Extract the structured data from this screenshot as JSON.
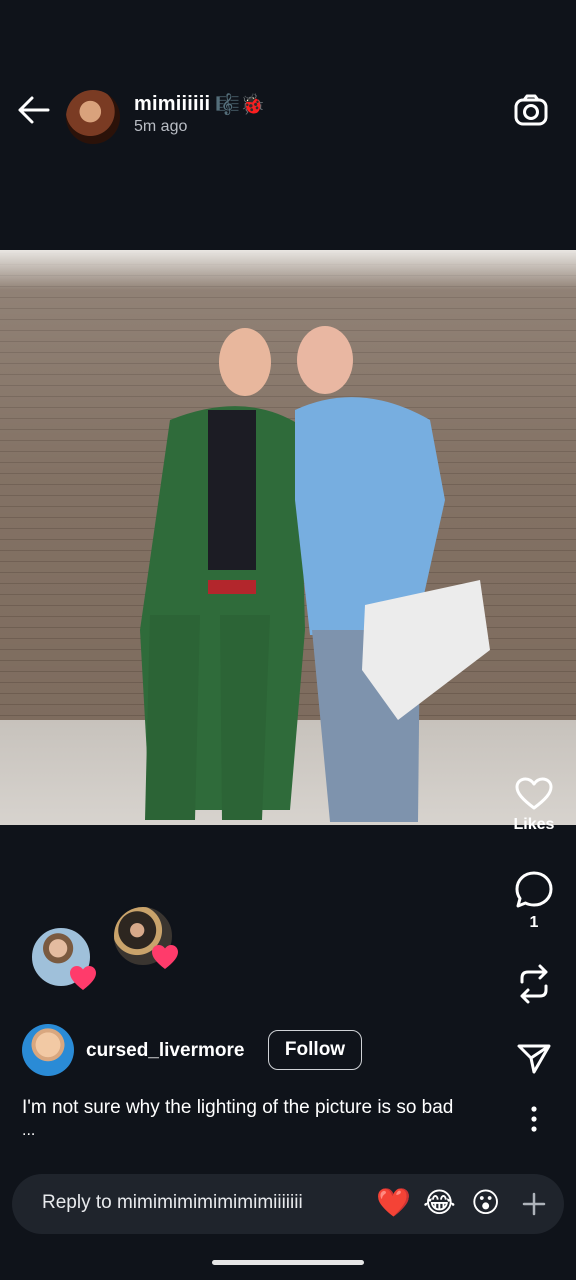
{
  "header": {
    "username": "mimiiiiii",
    "username_emoji": "🎼🐞",
    "timestamp": "5m ago",
    "back_icon": "arrow-left-icon",
    "camera_icon": "camera-icon"
  },
  "post": {
    "image_alt": "Two men posing in a hallway in front of a brick wall"
  },
  "actions": {
    "likes_label": "Likes",
    "comments_count": "1",
    "like_icon": "heart-outline-icon",
    "comment_icon": "comment-bubble-icon",
    "repost_icon": "repost-icon",
    "share_icon": "send-icon",
    "more_icon": "more-vertical-icon"
  },
  "likers": [
    {
      "name": "liker-1",
      "heart_color": "#ff3b6b"
    },
    {
      "name": "liker-2",
      "heart_color": "#ff3b6b"
    }
  ],
  "comment": {
    "username": "cursed_livermore",
    "follow_label": "Follow",
    "text": "I'm not sure why the lighting of the picture is so bad",
    "more": "..."
  },
  "reply": {
    "placeholder": "Reply to mimimimimimimimiiiiiii",
    "emojis": [
      "❤️",
      "😂",
      "😮"
    ],
    "add_icon": "plus-icon"
  },
  "colors": {
    "background": "#0f131a",
    "reply_bar": "#1f242c",
    "heart_badge": "#ff3b6b"
  }
}
